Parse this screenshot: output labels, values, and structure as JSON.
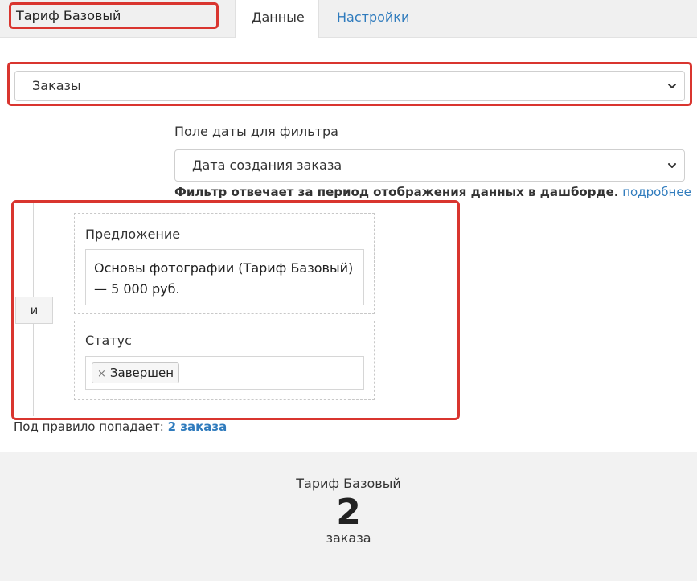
{
  "header": {
    "title_value": "Тариф Базовый",
    "tabs": [
      {
        "label": "Данные",
        "active": true
      },
      {
        "label": "Настройки",
        "active": false
      }
    ]
  },
  "source_select": {
    "selected": "Заказы"
  },
  "date_filter": {
    "label": "Поле даты для фильтра",
    "selected": "Дата создания заказа",
    "hint_bold": "Фильтр отвечает за период отображения данных в дашборде.",
    "hint_link": "подробнее"
  },
  "rules": {
    "operator_label": "и",
    "offer": {
      "label": "Предложение",
      "value": "Основы фотографии (Тариф Базовый) — 5 000 руб."
    },
    "status": {
      "label": "Статус",
      "tag_remove": "×",
      "tag": "Завершен"
    }
  },
  "match": {
    "prefix": "Под правило попадает:",
    "count_link": "2 заказа"
  },
  "summary": {
    "title": "Тариф Базовый",
    "count": "2",
    "unit": "заказа"
  },
  "colors": {
    "highlight": "#d9352f",
    "link": "#2f7bbd",
    "topbar_bg": "#f0f0f0",
    "summary_bg": "#f2f2f2"
  }
}
